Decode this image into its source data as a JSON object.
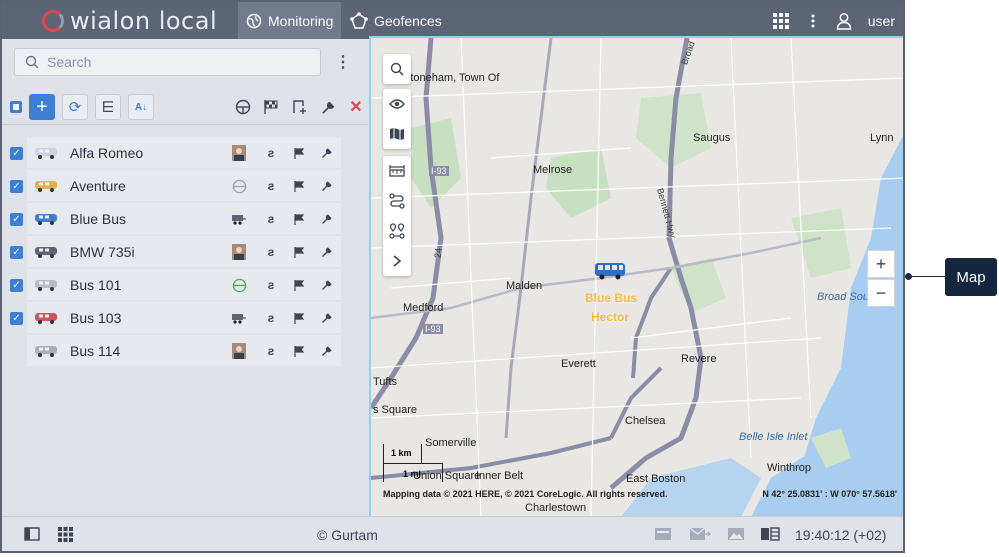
{
  "header": {
    "logo_text": "wialon local",
    "tabs": [
      {
        "label": "Monitoring",
        "icon": "globe-icon",
        "active": true
      },
      {
        "label": "Geofences",
        "icon": "geofence-icon",
        "active": false
      }
    ],
    "user_label": "user"
  },
  "sidebar": {
    "search_placeholder": "Search",
    "units": [
      {
        "name": "Alfa Romeo",
        "checked": true
      },
      {
        "name": "Aventure",
        "checked": true
      },
      {
        "name": "Blue Bus",
        "checked": true
      },
      {
        "name": "BMW 735i",
        "checked": true
      },
      {
        "name": "Bus 101",
        "checked": true
      },
      {
        "name": "Bus 103",
        "checked": true
      },
      {
        "name": "Bus 114",
        "checked": false
      }
    ]
  },
  "map": {
    "places": [
      "Stoneham, Town Of",
      "Saugus",
      "Lynn",
      "Melrose",
      "Malden",
      "Medford",
      "Everett",
      "Revere",
      "Chelsea",
      "Somerville",
      "Tufts",
      "s Square",
      "Union Square",
      "Inner Belt",
      "East Boston",
      "Winthrop",
      "Charlestown",
      "Broad Sou",
      "Belle Isle Inlet"
    ],
    "roads": [
      "I-93",
      "I-93",
      "Broad",
      "Bennett Hwy",
      "24"
    ],
    "unit_labels": [
      "Blue Bus",
      "Hector"
    ],
    "scale_labels": [
      "1 km",
      "1 mi"
    ],
    "copyright": "Mapping data © 2021 HERE, © 2021 CoreLogic. All rights reserved.",
    "coordinates": "N 42° 25.0831' : W 070° 57.5618'"
  },
  "footer": {
    "copyright": "© Gurtam",
    "time": "19:40:12 (+02)"
  },
  "callout": "Map",
  "colors": {
    "header": "#5d6476",
    "accent": "#3d7fd3",
    "unit_label": "#f5b942",
    "callout": "#14273f"
  }
}
